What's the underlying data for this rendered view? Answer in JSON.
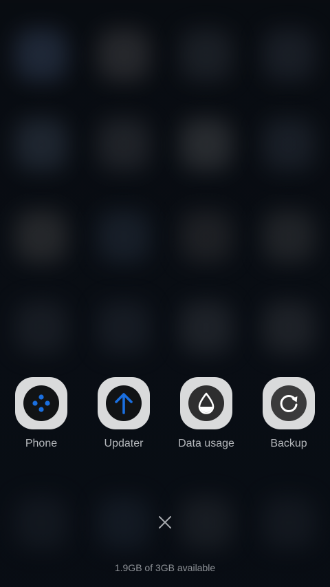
{
  "apps": [
    {
      "label": "Phone",
      "icon": "phone-dialpad-icon"
    },
    {
      "label": "Updater",
      "icon": "update-arrow-icon"
    },
    {
      "label": "Data usage",
      "icon": "water-drop-icon"
    },
    {
      "label": "Backup",
      "icon": "backup-refresh-icon"
    }
  ],
  "close_icon": "close-icon",
  "storage_text": "1.9GB of 3GB available",
  "colors": {
    "accent_blue": "#1a6fe0",
    "icon_frame": "#d9dadb",
    "icon_dark": "#2b2b2b",
    "label_text": "#b5b8bc"
  }
}
